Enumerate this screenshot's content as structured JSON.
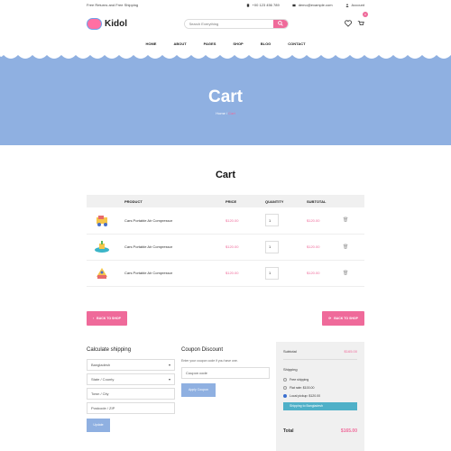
{
  "topbar": {
    "promo": "Free Returns and Free Shipping",
    "phone": "+00 123 456 789",
    "email": "demo@example.com",
    "account": "Account"
  },
  "header": {
    "brand": "Kidol",
    "search_placeholder": "Search Everything",
    "cart_count": "0"
  },
  "nav": [
    "HOME",
    "ABOUT",
    "PAGES",
    "SHOP",
    "BLOG",
    "CONTACT"
  ],
  "banner": {
    "title": "Cart",
    "crumb_home": "Home",
    "crumb_sep": " / ",
    "crumb_current": "Cart"
  },
  "cart": {
    "title": "Cart",
    "columns": [
      "PRODUCT",
      "PRICE",
      "QUANTITY",
      "SUBTOTAL"
    ],
    "rows": [
      {
        "name": "Cars Portable Air Compressor",
        "price": "$120.00",
        "qty": "1",
        "subtotal": "$120.00"
      },
      {
        "name": "Cars Portable Air Compressor",
        "price": "$120.00",
        "qty": "1",
        "subtotal": "$120.00"
      },
      {
        "name": "Cars Portable Air Compressor",
        "price": "$120.00",
        "qty": "1",
        "subtotal": "$120.00"
      }
    ],
    "back_btn": "BACK TO SHOP",
    "update_btn": "BACK TO SHOP"
  },
  "shipping": {
    "title": "Calculate shipping",
    "country": "Bangladesh",
    "state": "State / County",
    "city": "Town / City",
    "zip": "Postcode / ZIP",
    "update": "Update"
  },
  "coupon": {
    "title": "Coupon Discount",
    "note": "Enter your coupon code if you have one.",
    "placeholder": "Coupon code",
    "apply": "Apply Coupon"
  },
  "summary": {
    "subtotal_label": "Subtotal",
    "subtotal": "$165.00",
    "shipping_label": "Shipping",
    "options": [
      "Free shipping",
      "Flat rate: $100.00",
      "Local pickup: $120.00"
    ],
    "ship_to": "Shipping to Bangladesh",
    "total_label": "Total",
    "total": "$165.00"
  },
  "colors": {
    "accent": "#ef6a9a",
    "banner": "#8fb0e1",
    "ship": "#4fb0c8"
  }
}
